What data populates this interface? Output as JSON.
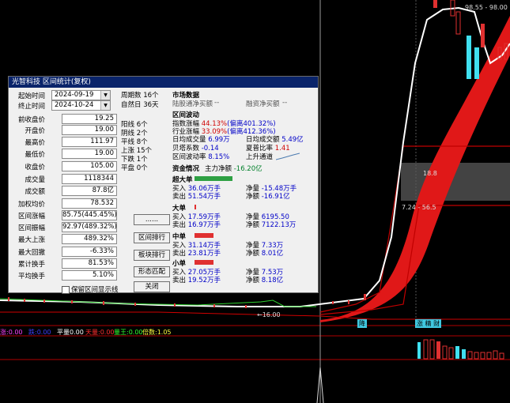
{
  "dialog": {
    "title": "光智科技  区间统计(复权)",
    "fields": [
      {
        "label": "起始时间",
        "value": "2024-09-19",
        "type": "date"
      },
      {
        "label": "终止时间",
        "value": "2024-10-24",
        "type": "date"
      },
      {
        "label": "前收盘价",
        "value": "19.25"
      },
      {
        "label": "开盘价",
        "value": "19.00"
      },
      {
        "label": "最高价",
        "value": "111.97"
      },
      {
        "label": "最低价",
        "value": "19.00"
      },
      {
        "label": "收盘价",
        "value": "105.00"
      },
      {
        "label": "成交量",
        "value": "1118344"
      },
      {
        "label": "成交额",
        "value": "87.8亿"
      },
      {
        "label": "加权均价",
        "value": "78.532"
      },
      {
        "label": "区间涨幅",
        "value": "85.75(445.45%)"
      },
      {
        "label": "区间振幅",
        "value": "92.97(489.32%)"
      },
      {
        "label": "最大上涨",
        "value": "489.32%"
      },
      {
        "label": "最大回撤",
        "value": "-6.33%"
      },
      {
        "label": "累计换手",
        "value": "81.53%"
      },
      {
        "label": "平均换手",
        "value": "5.10%"
      }
    ],
    "period_stats": [
      {
        "label": "周期数",
        "value": "16个"
      },
      {
        "label": "自然日",
        "value": "36天"
      }
    ],
    "candle_stats": [
      {
        "label": "阳线",
        "value": "6个"
      },
      {
        "label": "阴线",
        "value": "2个"
      },
      {
        "label": "平线",
        "value": "8个"
      },
      {
        "label": "上涨",
        "value": "15个"
      },
      {
        "label": "下跌",
        "value": "1个"
      },
      {
        "label": "平盘",
        "value": "0个"
      }
    ],
    "buttons": {
      "more": "......",
      "range_rank": "区间排行",
      "sector_rank": "板块排行",
      "pattern": "形态匹配",
      "close": "关闭"
    },
    "checkbox_label": "保留区间显示线"
  },
  "market": {
    "title": "市场数据",
    "left_label": "陆股通净买额",
    "left_value": "--",
    "right_label": "融资净买额",
    "right_value": "--"
  },
  "range": {
    "title": "区间波动",
    "index_change_label": "指数涨幅",
    "index_change_value": "44.13%",
    "index_change_extra": "(偏离401.32%)",
    "industry_change_label": "行业涨幅",
    "industry_change_value": "33.09%",
    "industry_change_extra": "(偏离412.36%)",
    "avg_vol_label": "日均成交量",
    "avg_vol_value": "6.99万",
    "avg_amt_label": "日均成交额",
    "avg_amt_value": "5.49亿",
    "beta_label": "贝塔系数",
    "beta_value": "-0.14",
    "sharpe_label": "夏普比率",
    "sharpe_value": "1.41",
    "volatility_label": "区间波动率",
    "volatility_value": "8.15%",
    "channel_label": "上升通道"
  },
  "capital": {
    "title": "资金情况",
    "main_label": "主力净额",
    "main_value": "-16.20亿",
    "groups": [
      {
        "name": "超大单",
        "bar_color": "#2ea043",
        "bar_fraction": 1.0,
        "buy_label": "买入",
        "buy": "36.06万手",
        "sell_label": "卖出",
        "sell": "51.54万手",
        "net_vol_label": "净量",
        "net_vol": "-15.48万手",
        "net_amt_label": "净额",
        "net_amt": "-16.91亿"
      },
      {
        "name": "大单",
        "bar_color": "#e03030",
        "bar_fraction": 0.04,
        "buy_label": "买入",
        "buy": "17.59万手",
        "sell_label": "卖出",
        "sell": "16.97万手",
        "net_vol_label": "净量",
        "net_vol": "6195.50",
        "net_amt_label": "净额",
        "net_amt": "7122.13万"
      },
      {
        "name": "中单",
        "bar_color": "#e03030",
        "bar_fraction": 0.5,
        "buy_label": "买入",
        "buy": "31.14万手",
        "sell_label": "卖出",
        "sell": "23.81万手",
        "net_vol_label": "净量",
        "net_vol": "7.33万",
        "net_amt_label": "净额",
        "net_amt": "8.01亿"
      },
      {
        "name": "小单",
        "bar_color": "#e03030",
        "bar_fraction": 0.5,
        "buy_label": "买入",
        "buy": "27.05万手",
        "sell_label": "卖出",
        "sell": "19.52万手",
        "net_vol_label": "净量",
        "net_vol": "7.53万",
        "net_amt_label": "净额",
        "net_amt": "8.18亿"
      }
    ]
  },
  "chart": {
    "price_top_label": "98.55 - 98.00",
    "price_mid_label": "18.8",
    "price_mid2_label": "7.24 - 56.5",
    "low_label": "←16.00",
    "marker_1": "降",
    "marker_2": "涨 精 财"
  },
  "indicator": {
    "items": [
      {
        "label": "涨:",
        "value": "0.00",
        "color": "#ff40ff"
      },
      {
        "label": "跌:",
        "value": "0.00",
        "color": "#4040ff"
      },
      {
        "label": "平量",
        "value": "0.00",
        "color": "#ffffff"
      },
      {
        "label": "天量:",
        "value": "0.00",
        "color": "#ff3030"
      },
      {
        "label": "量王:",
        "value": "0.00",
        "color": "#30ff30"
      },
      {
        "label": "倍数:",
        "value": "1.05",
        "color": "#ffff40"
      }
    ]
  }
}
